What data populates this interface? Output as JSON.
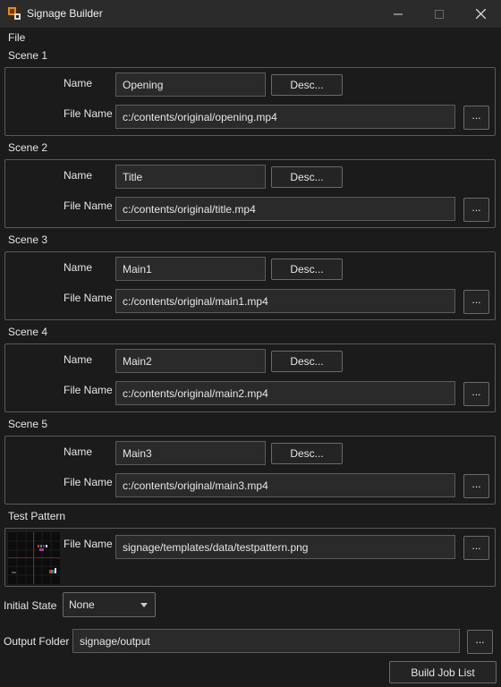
{
  "window": {
    "title": "Signage Builder",
    "minimize_icon": "minimize-icon",
    "maximize_icon": "maximize-icon",
    "close_icon": "close-icon"
  },
  "menu": {
    "file": "File"
  },
  "labels": {
    "name": "Name",
    "file_name": "File Name",
    "desc_button": "Desc...",
    "browse_button": "..."
  },
  "scenes": [
    {
      "label": "Scene 1",
      "name": "Opening",
      "file": "c:/contents/original/opening.mp4"
    },
    {
      "label": "Scene 2",
      "name": "Title",
      "file": "c:/contents/original/title.mp4"
    },
    {
      "label": "Scene 3",
      "name": "Main1",
      "file": "c:/contents/original/main1.mp4"
    },
    {
      "label": "Scene 4",
      "name": "Main2",
      "file": "c:/contents/original/main2.mp4"
    },
    {
      "label": "Scene 5",
      "name": "Main3",
      "file": "c:/contents/original/main3.mp4"
    }
  ],
  "test_pattern": {
    "label": "Test Pattern",
    "file": "signage/templates/data/testpattern.png"
  },
  "initial_state": {
    "label": "Initial State",
    "value": "None"
  },
  "output_folder": {
    "label": "Output Folder",
    "value": "signage/output"
  },
  "build_button": "Build Job List"
}
